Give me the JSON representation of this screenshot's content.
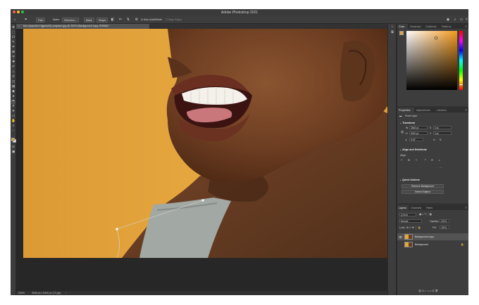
{
  "app": {
    "window_title": "Adobe Photoshop 2021",
    "traffic_colors": [
      "#fe5f57",
      "#febc2e",
      "#28c840"
    ]
  },
  "options_bar": {
    "auto_label": "Path",
    "make_label": "Make:",
    "make_value": "Selection...",
    "mask_label": "Mask",
    "shape_label": "Shape",
    "auto_add_delete_label": "Auto Add/Delete",
    "align_edges_label": "Align Edges"
  },
  "document": {
    "tab_title": "kim-carpenter-Hlgpdrz6Jj-unsplash.jpg @ 200% (Background copy, RGB/8) *",
    "zoom": "200%",
    "dimensions": "3548 px x 5440 px (72 ppi)"
  },
  "color_panel": {
    "tabs": [
      "Color",
      "Swatches",
      "Gradients",
      "Patterns"
    ],
    "hue_color": "#f39a1e"
  },
  "properties_panel": {
    "tabs": [
      "Properties",
      "Adjustments",
      "Libraries"
    ],
    "pixel_layer": "Pixel Layer",
    "transform_head": "Transform",
    "w_label": "W",
    "w_value": "3548 px",
    "h_label": "H",
    "h_value": "5440 px",
    "x_label": "X",
    "x_value": "0 px",
    "y_label": "Y",
    "y_value": "0 px",
    "angle_value": "0.00°",
    "align_head": "Align and Distribute",
    "align_sub": "Align:",
    "quick_head": "Quick Actions",
    "remove_bg": "Remove Background",
    "select_subject": "Select Subject"
  },
  "layers_panel": {
    "tabs": [
      "Layers",
      "Channels",
      "Paths"
    ],
    "kind_label": "Q Kind",
    "blend_mode": "Normal",
    "opacity_label": "Opacity:",
    "opacity_value": "100%",
    "lock_label": "Lock:",
    "fill_label": "Fill:",
    "fill_value": "100%",
    "layers": [
      {
        "name": "Background copy",
        "selected": true
      },
      {
        "name": "Background",
        "selected": false
      }
    ]
  },
  "colors": {
    "accent": "#1473e6",
    "foreground_swatch": "#e3a23f",
    "background_swatch": "#ffffff",
    "canvas_bg": "#e4a63c"
  }
}
